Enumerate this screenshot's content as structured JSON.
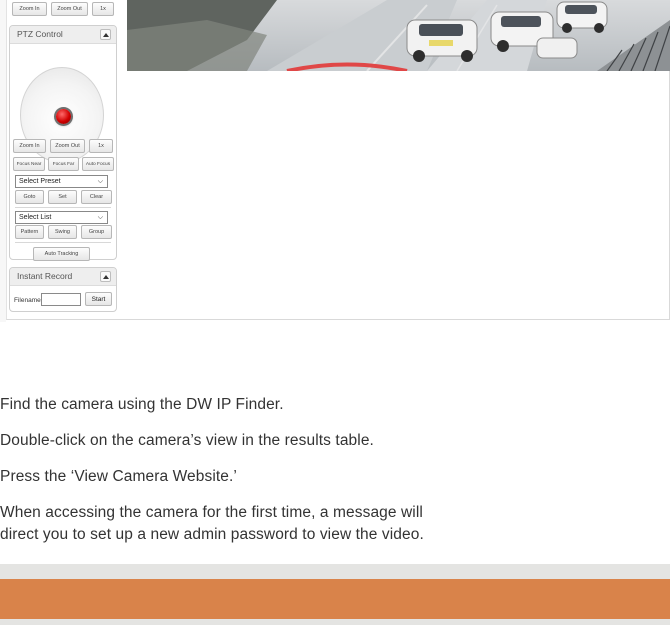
{
  "top_controls": {
    "zoom_in": "Zoom In",
    "zoom_out": "Zoom Out",
    "one_x": "1x"
  },
  "ptz": {
    "title": "PTZ Control",
    "zoom_in": "Zoom In",
    "zoom_out": "Zoom Out",
    "one_x": "1x",
    "focus_near": "Focus Near",
    "focus_far": "Focus Far",
    "auto_focus": "Auto Focus",
    "preset_select": "Select Preset",
    "goto": "Goto",
    "set": "Set",
    "clear": "Clear",
    "list_select": "Select List",
    "pattern": "Pattern",
    "swing": "Swing",
    "group": "Group",
    "auto_tracking": "Auto Tracking"
  },
  "instant_record": {
    "title": "Instant Record",
    "filename_label": "Filename",
    "filename_value": "",
    "start": "Start"
  },
  "steps": [
    "Find the camera using the DW IP Finder.",
    "Double-click on the camera’s view in the results table.",
    "Press the ‘View Camera Website.’",
    "When accessing the camera for the first time, a message will",
    "direct you to set up a new admin password to view the video."
  ],
  "colors": {
    "accent_band": "#d9834a",
    "band_light": "#e4e4e2",
    "joystick_knob": "#d10000",
    "text": "#333333"
  },
  "icons": {
    "collapse": "triangle-up-icon",
    "dropdown": "chevron-down-icon"
  }
}
